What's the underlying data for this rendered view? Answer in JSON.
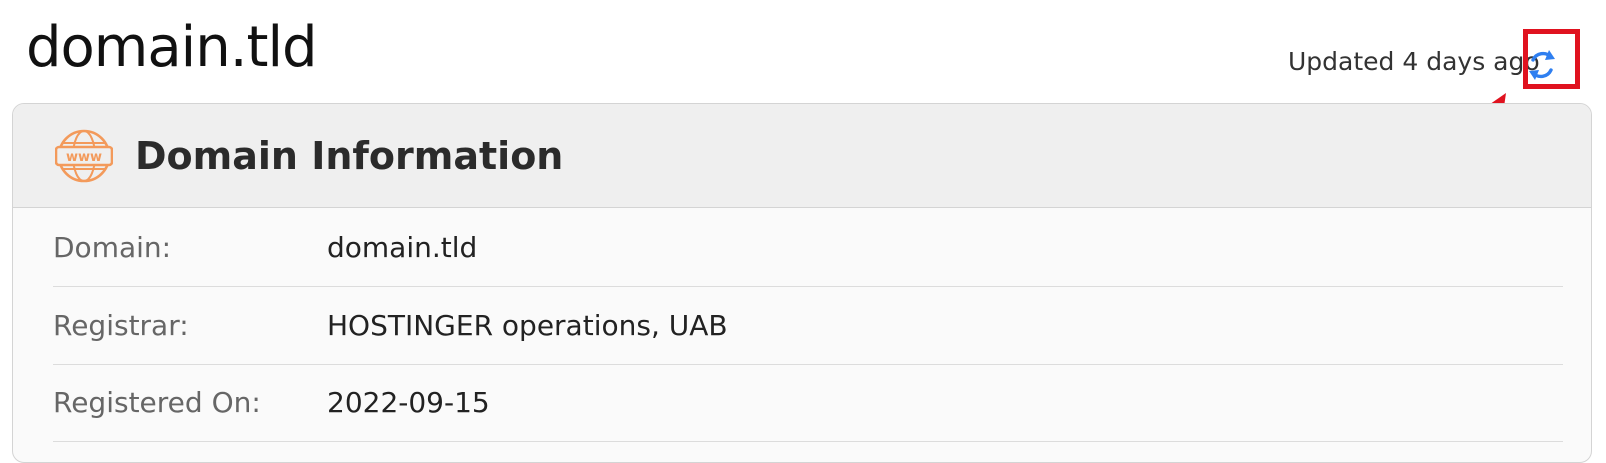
{
  "header": {
    "title": "domain.tld",
    "updated_text": "Updated 4 days ago",
    "refresh_icon": "refresh-icon",
    "accent_color": "#2f7ff0",
    "annotation_color": "#e0121f"
  },
  "panel": {
    "icon": "www-globe-icon",
    "icon_text": "www",
    "icon_color": "#f39a5b",
    "title": "Domain Information",
    "rows": [
      {
        "label": "Domain:",
        "value": "domain.tld"
      },
      {
        "label": "Registrar:",
        "value": "HOSTINGER operations, UAB"
      },
      {
        "label": "Registered On:",
        "value": "2022-09-15"
      }
    ]
  }
}
